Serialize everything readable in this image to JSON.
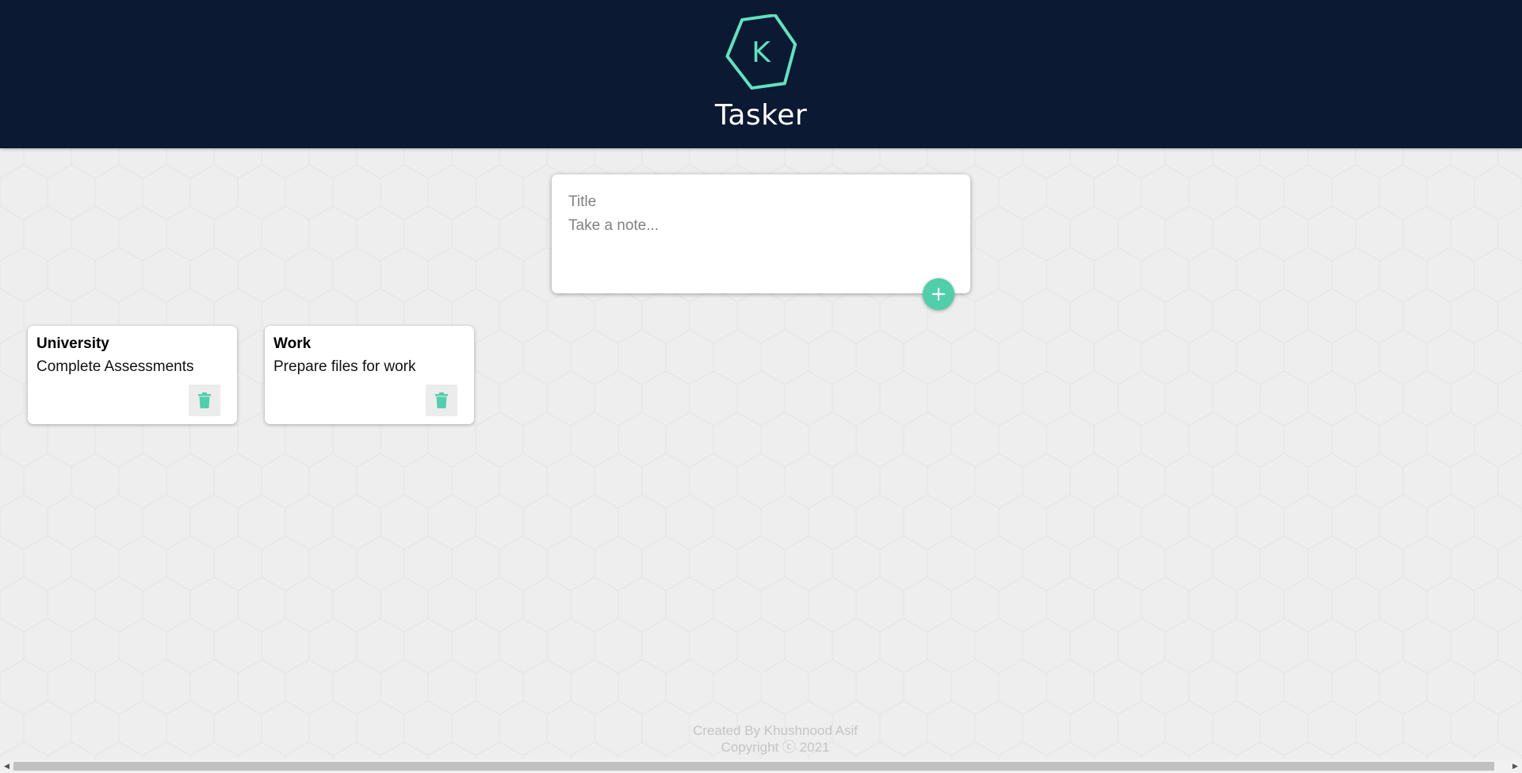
{
  "header": {
    "logo_letter": "K",
    "app_title": "Tasker"
  },
  "note_form": {
    "title_placeholder": "Title",
    "content_placeholder": "Take a note...",
    "add_icon": "plus-icon"
  },
  "notes": [
    {
      "title": "University",
      "content": "Complete Assessments",
      "delete_icon": "trash-icon"
    },
    {
      "title": "Work",
      "content": "Prepare files for work",
      "delete_icon": "trash-icon"
    }
  ],
  "footer": {
    "created_by": "Created By Khushnood Asif",
    "copyright": "Copyright ⓒ 2021"
  },
  "colors": {
    "header_bg": "#0b1932",
    "accent": "#4fcfaa",
    "page_bg": "#eeeeee"
  }
}
